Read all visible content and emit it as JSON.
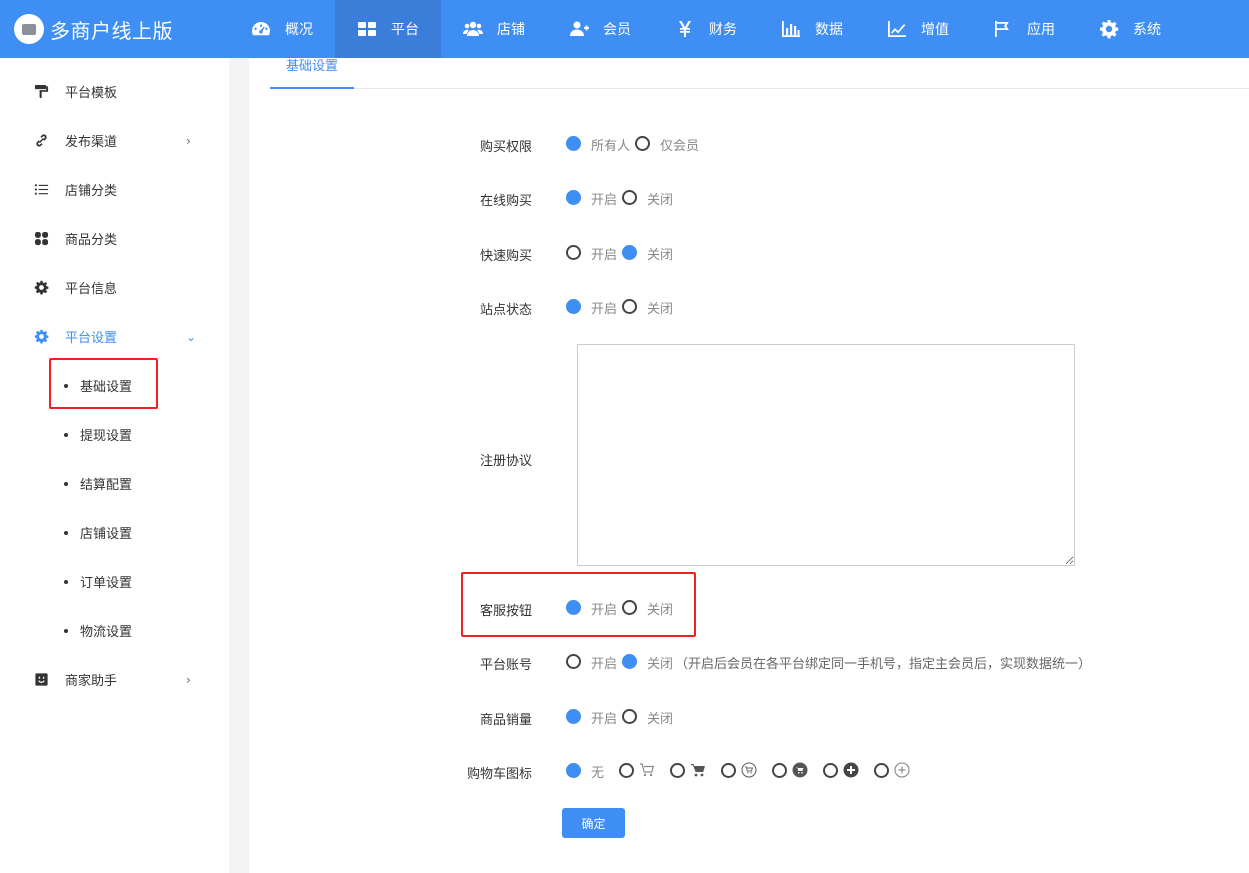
{
  "brand": {
    "title": "多商户线上版"
  },
  "nav": [
    {
      "label": "概况",
      "icon": "dashboard-icon"
    },
    {
      "label": "平台",
      "icon": "grid-icon",
      "active": true
    },
    {
      "label": "店铺",
      "icon": "users-icon"
    },
    {
      "label": "会员",
      "icon": "user-plus-icon"
    },
    {
      "label": "财务",
      "icon": "yen-icon"
    },
    {
      "label": "数据",
      "icon": "bar-chart-icon"
    },
    {
      "label": "增值",
      "icon": "line-chart-icon"
    },
    {
      "label": "应用",
      "icon": "flag-icon"
    },
    {
      "label": "系统",
      "icon": "gear-icon"
    }
  ],
  "sidebar": {
    "items": [
      {
        "label": "平台模板",
        "icon": "paint-roller-icon"
      },
      {
        "label": "发布渠道",
        "icon": "link-icon",
        "arrow": "›"
      },
      {
        "label": "店铺分类",
        "icon": "list-icon"
      },
      {
        "label": "商品分类",
        "icon": "apps-icon"
      },
      {
        "label": "平台信息",
        "icon": "gear-icon"
      },
      {
        "label": "平台设置",
        "icon": "gear-icon",
        "arrow": "⌄",
        "open": true
      },
      {
        "label": "商家助手",
        "icon": "smile-icon",
        "arrow": "›"
      }
    ],
    "sub_items": [
      {
        "label": "基础设置",
        "active": true
      },
      {
        "label": "提现设置"
      },
      {
        "label": "结算配置"
      },
      {
        "label": "店铺设置"
      },
      {
        "label": "订单设置"
      },
      {
        "label": "物流设置"
      }
    ]
  },
  "tabs": [
    {
      "label": "基础设置"
    }
  ],
  "form": {
    "purchase_permission": {
      "label": "购买权限",
      "options": [
        "所有人",
        "仅会员"
      ],
      "selected": 0
    },
    "online_purchase": {
      "label": "在线购买",
      "options": [
        "开启",
        "关闭"
      ],
      "selected": 0
    },
    "quick_purchase": {
      "label": "快速购买",
      "options": [
        "开启",
        "关闭"
      ],
      "selected": 1
    },
    "site_status": {
      "label": "站点状态",
      "options": [
        "开启",
        "关闭"
      ],
      "selected": 0
    },
    "register_agreement": {
      "label": "注册协议",
      "value": ""
    },
    "service_button": {
      "label": "客服按钮",
      "options": [
        "开启",
        "关闭"
      ],
      "selected": 0
    },
    "platform_account": {
      "label": "平台账号",
      "options": [
        "开启",
        "关闭"
      ],
      "selected": 1,
      "note": "（开启后会员在各平台绑定同一手机号，指定主会员后，实现数据统一）"
    },
    "product_sales": {
      "label": "商品销量",
      "options": [
        "开启",
        "关闭"
      ],
      "selected": 0
    },
    "cart_icon": {
      "label": "购物车图标",
      "none_label": "无",
      "selected": 0,
      "icons": [
        "cart-outline-icon",
        "cart-solid-icon",
        "cart-circle-outline-icon",
        "cart-circle-solid-icon",
        "plus-circle-solid-icon",
        "plus-circle-outline-icon"
      ]
    },
    "submit_label": "确定"
  },
  "highlight_color": "#ee2222",
  "accent_color": "#3f8ef3"
}
